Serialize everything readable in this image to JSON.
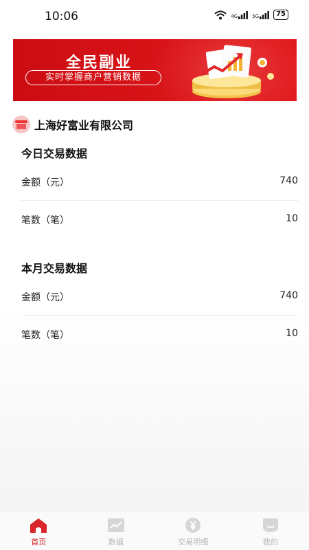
{
  "status_bar": {
    "time": "10:06",
    "signal_labels": [
      "4G",
      "5G"
    ],
    "battery": "75"
  },
  "banner": {
    "title": "全民副业",
    "subtitle": "实时掌握商户营销数据"
  },
  "company": {
    "name": "上海好富业有限公司"
  },
  "today": {
    "title": "今日交易数据",
    "amount_label": "金额（元）",
    "amount_value": "740",
    "count_label": "笔数（笔）",
    "count_value": "10"
  },
  "month": {
    "title": "本月交易数据",
    "amount_label": "金额（元）",
    "amount_value": "740",
    "count_label": "笔数（笔）",
    "count_value": "10"
  },
  "nav": {
    "items": [
      {
        "label": "首页",
        "icon": "home-icon",
        "active": true
      },
      {
        "label": "数据",
        "icon": "chart-icon",
        "active": false
      },
      {
        "label": "交易明细",
        "icon": "yuan-icon",
        "active": false
      },
      {
        "label": "我的",
        "icon": "profile-icon",
        "active": false
      }
    ]
  },
  "colors": {
    "accent": "#d8262b",
    "banner_red": "#d81418",
    "inactive": "#b5b5b5"
  }
}
